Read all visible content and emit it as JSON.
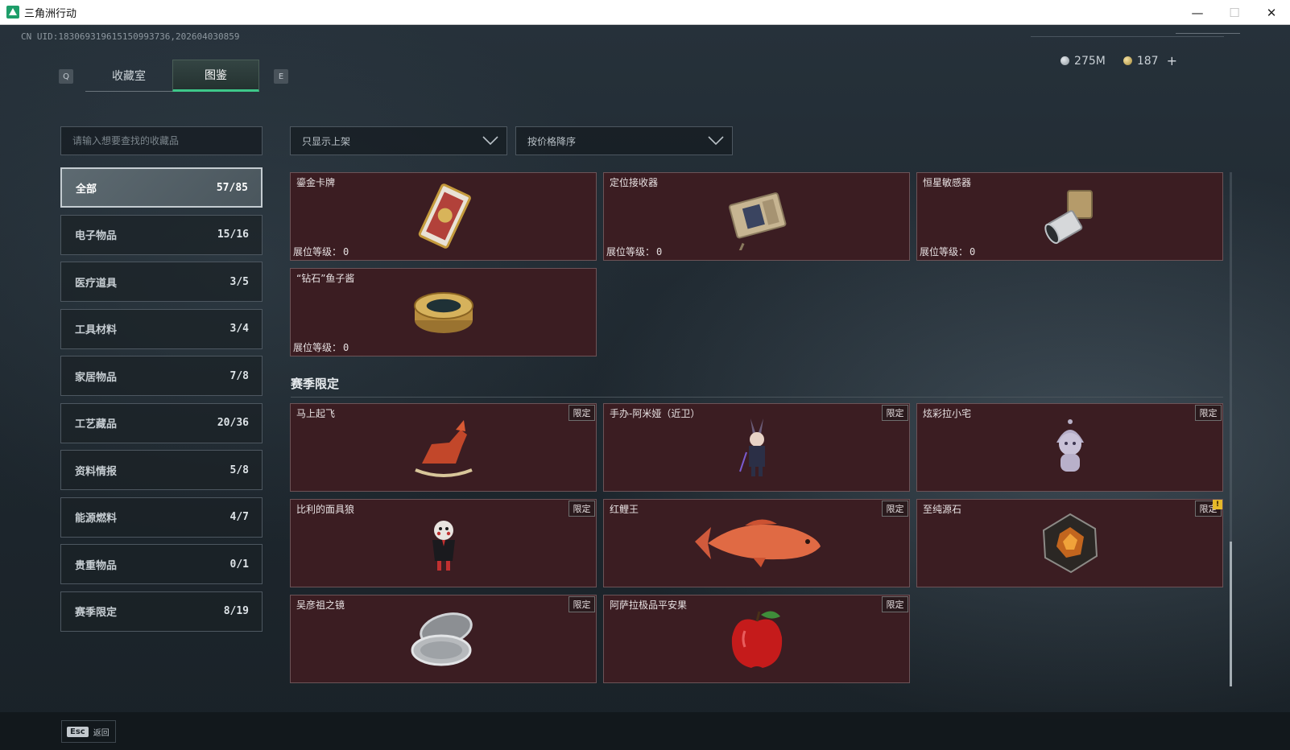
{
  "window": {
    "title": "三角洲行动",
    "minimize": "—",
    "maximize": "☐",
    "close": "✕"
  },
  "header": {
    "uid": "CN UID:183069319615150993736,202604030859",
    "currency": [
      {
        "icon": "silver-coin-icon",
        "value": "275M"
      },
      {
        "icon": "gold-coin-icon",
        "value": "187"
      }
    ],
    "add_label": "+"
  },
  "tabs": {
    "prev_key": "Q",
    "next_key": "E",
    "items": [
      {
        "label": "收藏室",
        "active": false
      },
      {
        "label": "图鉴",
        "active": true
      }
    ]
  },
  "search": {
    "placeholder": "请输入想要查找的收藏品",
    "value": ""
  },
  "categories": [
    {
      "name": "全部",
      "count": "57/85",
      "active": true
    },
    {
      "name": "电子物品",
      "count": "15/16"
    },
    {
      "name": "医疗道具",
      "count": "3/5"
    },
    {
      "name": "工具材料",
      "count": "3/4"
    },
    {
      "name": "家居物品",
      "count": "7/8"
    },
    {
      "name": "工艺藏品",
      "count": "20/36"
    },
    {
      "name": "资料情报",
      "count": "5/8"
    },
    {
      "name": "能源燃料",
      "count": "4/7"
    },
    {
      "name": "贵重物品",
      "count": "0/1"
    },
    {
      "name": "赛季限定",
      "count": "8/19"
    }
  ],
  "filters": {
    "shelf_filter": "只显示上架",
    "sort": "按价格降序"
  },
  "items": [
    {
      "name": "鎏金卡牌",
      "level_label": "展位等级：",
      "level": "0",
      "icon": "gilded-card-icon"
    },
    {
      "name": "定位接收器",
      "level_label": "展位等级：",
      "level": "0",
      "icon": "locator-receiver-icon"
    },
    {
      "name": "恒星敏感器",
      "level_label": "展位等级：",
      "level": "0",
      "icon": "star-sensor-icon"
    },
    {
      "name": "“钻石”鱼子酱",
      "level_label": "展位等级：",
      "level": "0",
      "icon": "caviar-tin-icon"
    }
  ],
  "season_section": {
    "title": "赛季限定",
    "badge": "限定",
    "items": [
      {
        "name": "马上起飞",
        "icon": "rocking-horse-icon"
      },
      {
        "name": "手办-阿米娅（近卫）",
        "icon": "figure-amiya-icon"
      },
      {
        "name": "炫彩拉小宅",
        "icon": "plush-doll-icon"
      },
      {
        "name": "比利的面具狼",
        "icon": "billy-puppet-icon"
      },
      {
        "name": "红鲤王",
        "icon": "red-carp-icon"
      },
      {
        "name": "至纯源石",
        "icon": "originium-icon",
        "notification": "!"
      },
      {
        "name": "吴彦祖之镜",
        "icon": "compact-mirror-icon"
      },
      {
        "name": "阿萨拉极品平安果",
        "icon": "red-apple-icon"
      }
    ]
  },
  "footer": {
    "esc_key": "Esc",
    "back_label": "返回"
  },
  "colors": {
    "accent": "#3ec88a",
    "card_bg": "#3b1d22",
    "badge_notif": "#e5b92a"
  }
}
